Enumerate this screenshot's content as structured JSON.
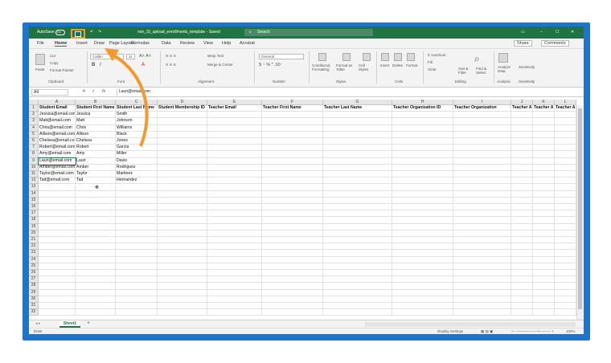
{
  "titlebar": {
    "autosave": "AutoSave",
    "toggle": "On",
    "filename": "non_SI_upload_enrollments_template - Saved",
    "search": "Search"
  },
  "menu": {
    "items": [
      "File",
      "Home",
      "Insert",
      "Draw",
      "Page Layout",
      "Formulas",
      "Data",
      "Review",
      "View",
      "Help",
      "Acrobat"
    ],
    "share": "Share",
    "comments": "Comments"
  },
  "ribbon": {
    "clipboard": {
      "paste": "Paste",
      "cut": "Cut",
      "copy": "Copy",
      "format_painter": "Format Painter",
      "label": "Clipboard"
    },
    "font": {
      "name": "Calibri",
      "size": "11",
      "label": "Font"
    },
    "alignment": {
      "wrap": "Wrap Text",
      "merge": "Merge & Center",
      "label": "Alignment"
    },
    "number": {
      "format": "General",
      "label": "Number"
    },
    "styles": {
      "conditional": "Conditional Formatting",
      "format_as": "Format as Table",
      "cell_styles": "Cell Styles",
      "label": "Styles"
    },
    "cells": {
      "insert": "Insert",
      "delete": "Delete",
      "format": "Format",
      "label": "Cells"
    },
    "editing": {
      "autosum": "AutoSum",
      "fill": "Fill",
      "clear": "Clear",
      "sort": "Sort & Filter",
      "find": "Find & Select",
      "label": "Editing"
    },
    "analysis": {
      "analyze": "Analyze Data",
      "label": "Analysis"
    },
    "sensitivity": {
      "label": "Sensitivity",
      "btn": "Sensitivity"
    }
  },
  "formula": {
    "namebox": "A9",
    "value": "Lauri@email.com"
  },
  "columns": [
    "A",
    "B",
    "C",
    "D",
    "E",
    "F",
    "G",
    "H",
    "I",
    "J",
    "K",
    "L"
  ],
  "headers": [
    "Student Email",
    "Student First Name",
    "Student Last Name",
    "Student Membership ID",
    "Teacher Email",
    "Teacher First Name",
    "Teacher Last Name",
    "Teacher Organization ID",
    "Teacher Organization",
    "Teacher A",
    "Teacher A",
    "Teacher A"
  ],
  "rows": [
    [
      "Jessica@email.com",
      "Jessica",
      "Smith"
    ],
    [
      "Matt@email.com",
      "Matt",
      "Johnson"
    ],
    [
      "Chris@email.com",
      "Chris",
      "Williams"
    ],
    [
      "Allison@email.com",
      "Allison",
      "Black"
    ],
    [
      "Chelsea@email.com",
      "Chelsea",
      "Jones"
    ],
    [
      "Robert@email.com",
      "Robert",
      "Garcia"
    ],
    [
      "Amy@email.com",
      "Amy",
      "Miller"
    ],
    [
      "Lauri@email.com",
      "Lauri",
      "Davis"
    ],
    [
      "Amber@email.com",
      "Amber",
      "Rodriguez"
    ],
    [
      "Taylor@email.com",
      "Taylor",
      "Martinez"
    ],
    [
      "Tad@email.com",
      "Tad",
      "Hernandez"
    ]
  ],
  "row_numbers": [
    "1",
    "2",
    "3",
    "4",
    "5",
    "6",
    "7",
    "8",
    "9",
    "10",
    "11",
    "12",
    "13",
    "14",
    "15",
    "16",
    "17",
    "18",
    "19",
    "20",
    "21",
    "22",
    "23",
    "24",
    "25",
    "26",
    "27",
    "28",
    "29",
    "30",
    "31",
    "32"
  ],
  "sheet": {
    "tab": "Sheet1",
    "add": "+"
  },
  "status": {
    "mode": "Enter",
    "display": "Display Settings",
    "zoom": "100%"
  },
  "colors": {
    "excel_green": "#217346",
    "highlight_orange": "#f39a2e",
    "frame_blue": "#1e74c8"
  }
}
